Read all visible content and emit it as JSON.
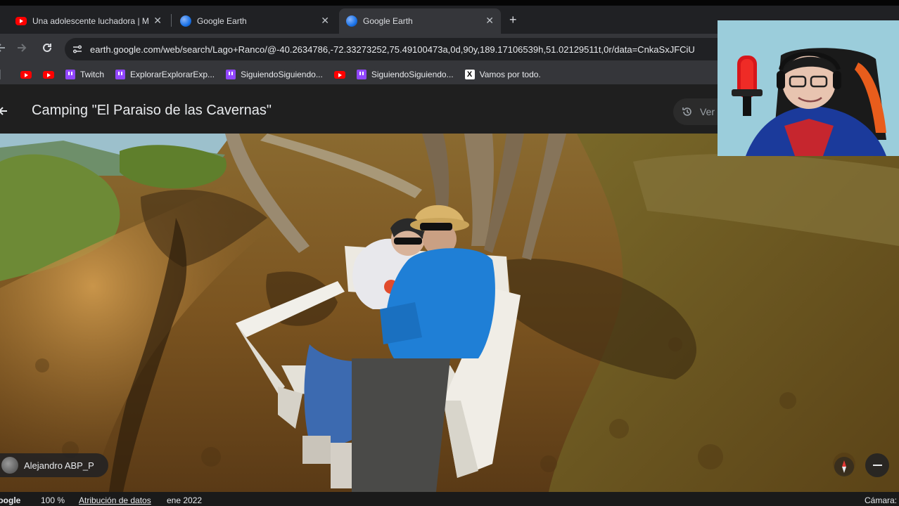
{
  "browser": {
    "tabs": [
      {
        "title": "Una adolescente luchadora | M",
        "favicon": "youtube-icon",
        "active": false
      },
      {
        "title": "Google Earth",
        "favicon": "globe-icon",
        "active": false
      },
      {
        "title": "Google Earth",
        "favicon": "globe-icon",
        "active": true
      }
    ],
    "new_tab_symbol": "+",
    "close_symbol": "✕",
    "url": "earth.google.com/web/search/Lago+Ranco/@-40.2634786,-72.33273252,75.49100473a,0d,90y,189.17106539h,51.02129511t,0r/data=CnkaSxJFCiU",
    "bookmarks": [
      {
        "type": "youtube",
        "label": ""
      },
      {
        "type": "youtube",
        "label": ""
      },
      {
        "type": "twitch",
        "label": "Twitch"
      },
      {
        "type": "twitch",
        "label": "ExplorarExplorarExp..."
      },
      {
        "type": "twitch",
        "label": "SiguiendoSiguiendo..."
      },
      {
        "type": "youtube",
        "label": ""
      },
      {
        "type": "twitch",
        "label": "SiguiendoSiguiendo..."
      },
      {
        "type": "x",
        "label": "Vamos por todo."
      }
    ]
  },
  "earth": {
    "place_title": "Camping \"El Paraiso de las Cavernas\"",
    "history_button": "Ver",
    "author": "Alejandro ABP_P",
    "status": {
      "logo": "Google",
      "zoom": "100 %",
      "attribution": "Atribución de datos",
      "date": "ene 2022",
      "camera": "Cámara:"
    }
  },
  "colors": {
    "chrome_dark": "#202124",
    "chrome_mid": "#35363a",
    "earth_header": "#1f1f1f",
    "youtube_red": "#ff0000",
    "twitch_purple": "#9146ff"
  }
}
